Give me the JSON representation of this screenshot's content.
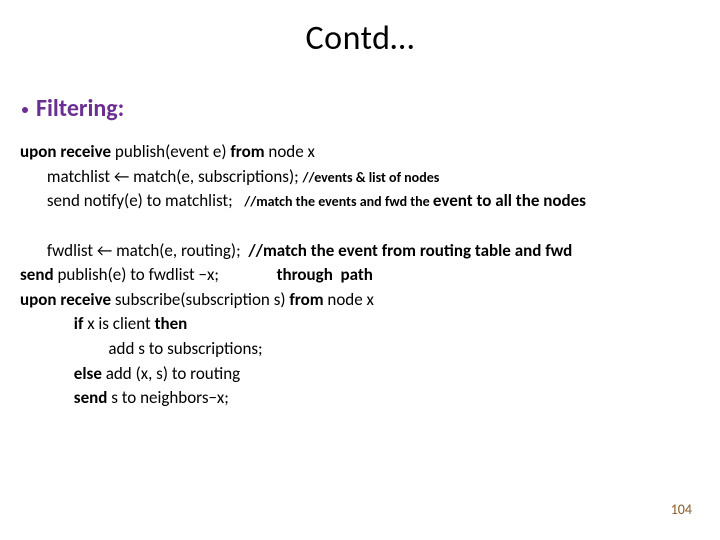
{
  "title": "Contd…",
  "heading": "Filtering:",
  "lines": {
    "l1a": "upon receive ",
    "l1b": "publish(event e) ",
    "l1c": "from ",
    "l1d": "node x",
    "l2a": "       matchlist ← match(e, subscriptions); ",
    "l2b": "//events & list of nodes",
    "l3a": "       send ",
    "l3b": "notify(e) to matchlist;   ",
    "l3c": "//match the events and fwd the ",
    "l3d": "event ",
    "l3e": "to all the nodes",
    "l4a": "       fwdlist ← match(e, routing);  ",
    "l4b": "//match the event from routing table and fwd",
    "l5a": "send ",
    "l5b": "publish(e) to fwdlist −x;               ",
    "l5c": "through  path",
    "l6a": "upon receive ",
    "l6b": "subscribe(subscription s) ",
    "l6c": "from ",
    "l6d": "node x",
    "l7a": "              if ",
    "l7b": "x is client ",
    "l7c": "then",
    "l8": "                       add s to subscriptions;",
    "l9a": "              else ",
    "l9b": "add (x, s) to routing",
    "l10a": "              send ",
    "l10b": "s to neighbors−x;"
  },
  "pagenum": "104"
}
